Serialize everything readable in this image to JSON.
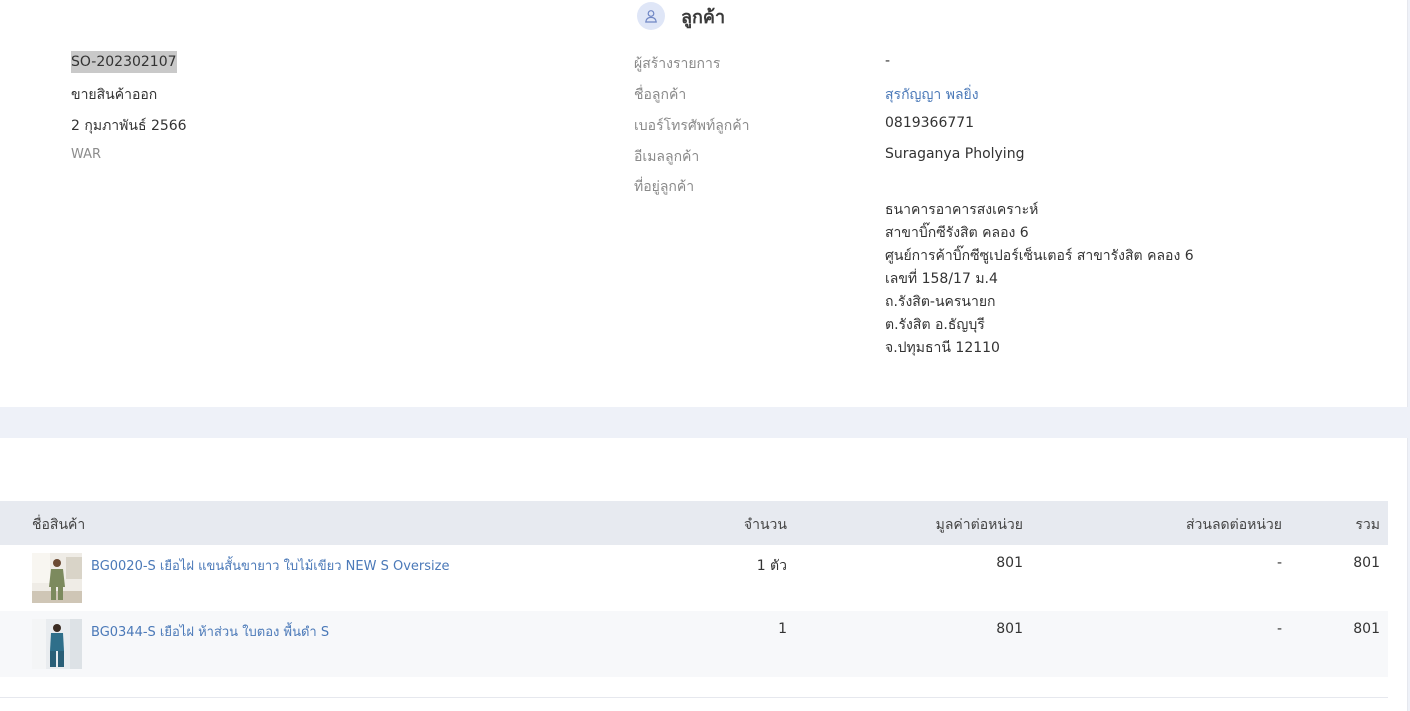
{
  "customer_section": {
    "title": "ลูกค้า",
    "icon": "user-icon"
  },
  "order": {
    "id": "SO-202302107",
    "type": "ขายสินค้าออก",
    "date": "2 กุมภาพันธ์ 2566",
    "warehouse": "WAR"
  },
  "details": {
    "creator_label": "ผู้สร้างรายการ",
    "creator_value": "-",
    "customer_name_label": "ชื่อลูกค้า",
    "customer_name_value": "สุรกัญญา พลยิ่ง",
    "phone_label": "เบอร์โทรศัพท์ลูกค้า",
    "phone_value": "0819366771",
    "email_label": "อีเมลลูกค้า",
    "email_value": "Suraganya Pholying",
    "address_label": "ที่อยู่ลูกค้า",
    "address_lines": [
      "ธนาคารอาคารสงเคราะห์",
      "สาขาบิ๊กซีรังสิต คลอง 6",
      "ศูนย์การค้าบิ๊กซีซูเปอร์เซ็นเตอร์ สาขารังสิต คลอง 6",
      "เลขที่ 158/17 ม.4",
      "ถ.รังสิต-นครนายก",
      "ต.รังสิต อ.ธัญบุรี",
      "จ.ปทุมธานี 12110"
    ]
  },
  "table": {
    "headers": {
      "name": "ชื่อสินค้า",
      "qty": "จำนวน",
      "unit_price": "มูลค่าต่อหน่วย",
      "unit_discount": "ส่วนลดต่อหน่วย",
      "total": "รวม"
    },
    "rows": [
      {
        "name": "BG0020-S เยือไฝ แขนสั้นขายาว ใบไม้เขียว NEW S Oversize",
        "qty": "1 ตัว",
        "unit_price": "801",
        "unit_discount": "-",
        "total": "801"
      },
      {
        "name": "BG0344-S เยือไฝ ห้าส่วน ใบตอง พื้นดำ S",
        "qty": "1",
        "unit_price": "801",
        "unit_discount": "-",
        "total": "801"
      }
    ]
  }
}
